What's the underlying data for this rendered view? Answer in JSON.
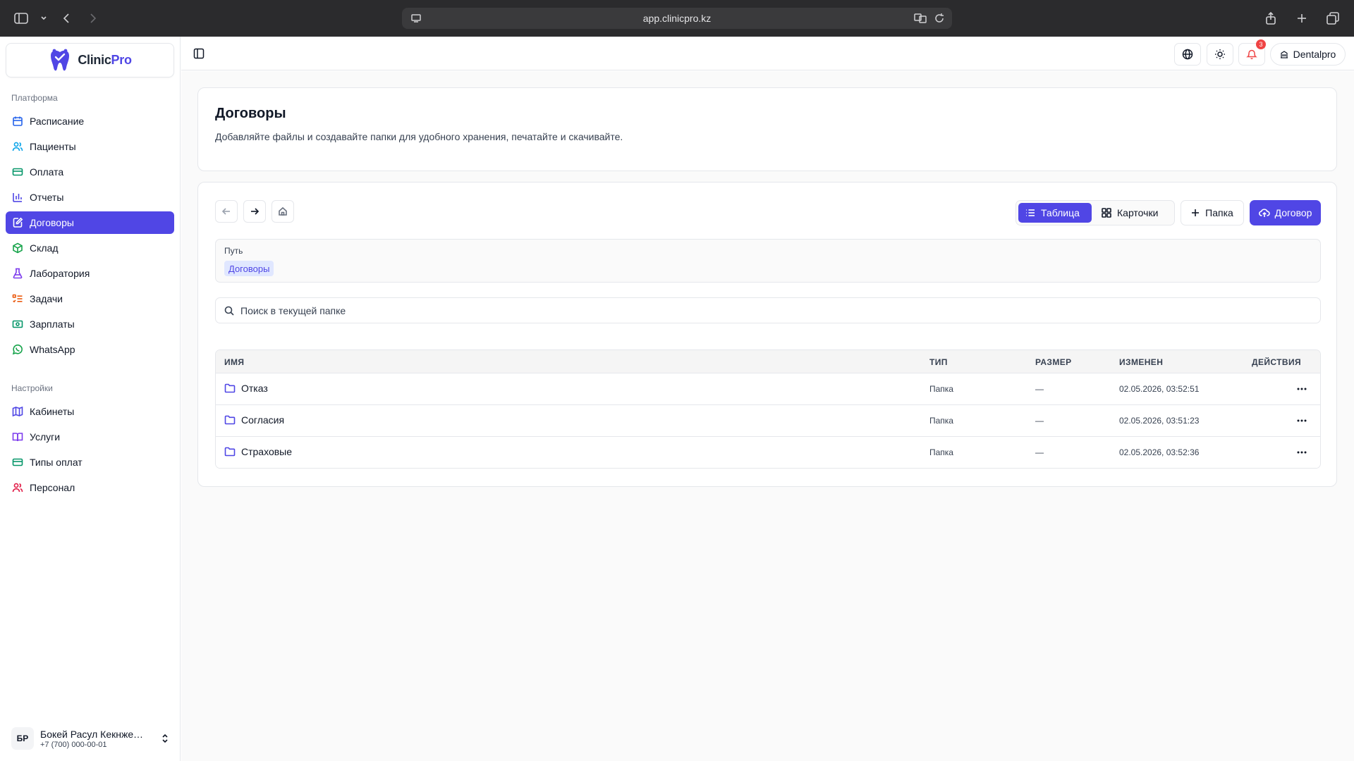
{
  "browser": {
    "url": "app.clinicpro.kz"
  },
  "brand": {
    "name_part1": "Clinic",
    "name_part2": "Pro",
    "accent": "#5046e5"
  },
  "sidebar": {
    "group1_label": "Платформа",
    "group1_items": [
      {
        "label": "Расписание",
        "icon": "calendar-icon",
        "color": "#2563eb"
      },
      {
        "label": "Пациенты",
        "icon": "users-icon",
        "color": "#0ea5e9"
      },
      {
        "label": "Оплата",
        "icon": "credit-card-icon",
        "color": "#059669"
      },
      {
        "label": "Отчеты",
        "icon": "bar-chart-icon",
        "color": "#4f46e5"
      },
      {
        "label": "Договоры",
        "icon": "file-edit-icon",
        "color": "#ffffff",
        "active": true
      },
      {
        "label": "Склад",
        "icon": "package-icon",
        "color": "#16a34a"
      },
      {
        "label": "Лаборатория",
        "icon": "flask-icon",
        "color": "#7c3aed"
      },
      {
        "label": "Задачи",
        "icon": "list-todo-icon",
        "color": "#ea580c"
      },
      {
        "label": "Зарплаты",
        "icon": "banknote-icon",
        "color": "#059669"
      },
      {
        "label": "WhatsApp",
        "icon": "whatsapp-icon",
        "color": "#16a34a"
      }
    ],
    "group2_label": "Настройки",
    "group2_items": [
      {
        "label": "Кабинеты",
        "icon": "map-icon",
        "color": "#4f46e5"
      },
      {
        "label": "Услуги",
        "icon": "book-icon",
        "color": "#7c3aed"
      },
      {
        "label": "Типы оплат",
        "icon": "card-icon",
        "color": "#059669"
      },
      {
        "label": "Персонал",
        "icon": "staff-icon",
        "color": "#e11d48"
      }
    ],
    "user": {
      "initials": "БР",
      "name": "Бокей Расул Кекнжебаевич",
      "phone": "+7 (700) 000-00-01"
    }
  },
  "topbar": {
    "notifications_count": "3",
    "clinic_name": "Dentalpro"
  },
  "page": {
    "title": "Договоры",
    "description": "Добавляйте файлы и создавайте папки для удобного хранения, печатайте и скачивайте."
  },
  "toolbar": {
    "view_table": "Таблица",
    "view_cards": "Карточки",
    "new_folder": "Папка",
    "new_contract": "Договор"
  },
  "path": {
    "label": "Путь",
    "crumb": "Договоры"
  },
  "search": {
    "placeholder": "Поиск в текущей папке"
  },
  "table": {
    "headers": {
      "name": "ИМЯ",
      "type": "ТИП",
      "size": "РАЗМЕР",
      "modified": "ИЗМЕНЕН",
      "actions": "ДЕЙСТВИЯ"
    },
    "rows": [
      {
        "name": "Отказ",
        "type": "Папка",
        "size": "—",
        "modified": "02.05.2026, 03:52:51"
      },
      {
        "name": "Согласия",
        "type": "Папка",
        "size": "—",
        "modified": "02.05.2026, 03:51:23"
      },
      {
        "name": "Страховые",
        "type": "Папка",
        "size": "—",
        "modified": "02.05.2026, 03:52:36"
      }
    ]
  }
}
